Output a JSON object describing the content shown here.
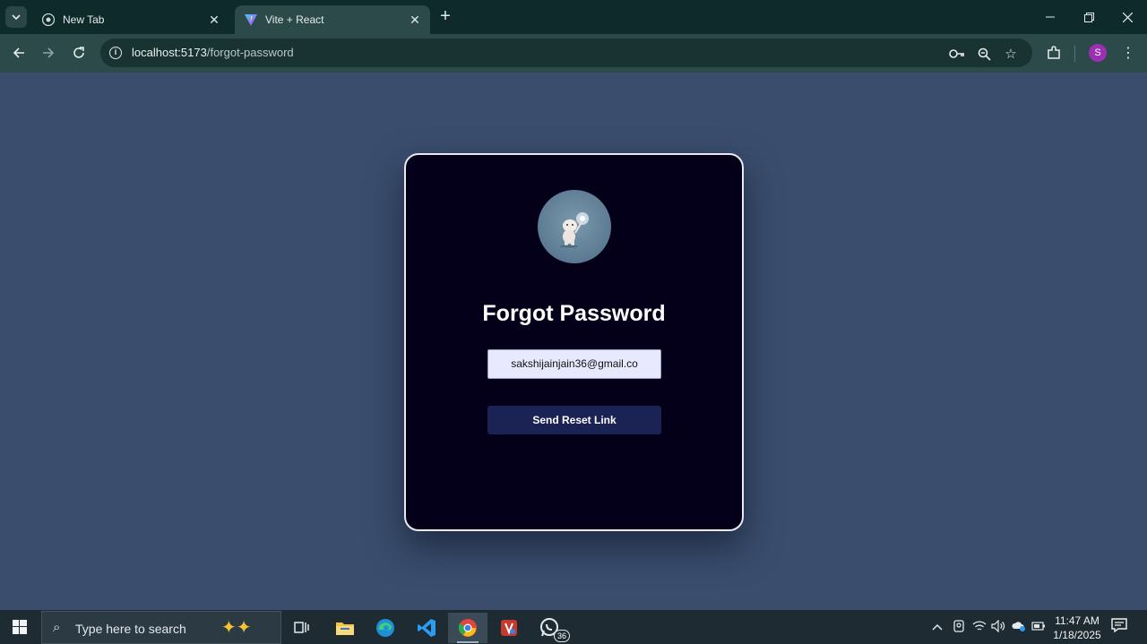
{
  "browser": {
    "tabs": [
      {
        "title": "New Tab",
        "active": false,
        "icon": "chrome-icon"
      },
      {
        "title": "Vite + React",
        "active": true,
        "icon": "vite-icon"
      }
    ],
    "url_host": "localhost:5173",
    "url_path": "/forgot-password",
    "profile_initial": "S",
    "profile_color": "#9c2fb3"
  },
  "page": {
    "heading": "Forgot Password",
    "email_value": "sakshijainjain36@gmail.co",
    "button_label": "Send Reset Link",
    "colors": {
      "page_bg": "#3a4d6d",
      "card_bg": "#04001a",
      "input_bg": "#e8e9ff",
      "button_bg": "#1a2353"
    }
  },
  "taskbar": {
    "search_placeholder": "Type here to search",
    "apps": [
      "task-view",
      "file-explorer",
      "edge",
      "vs-code",
      "chrome",
      "app",
      "whatsapp"
    ],
    "whatsapp_badge": "36",
    "time": "11:47 AM",
    "date": "1/18/2025"
  }
}
